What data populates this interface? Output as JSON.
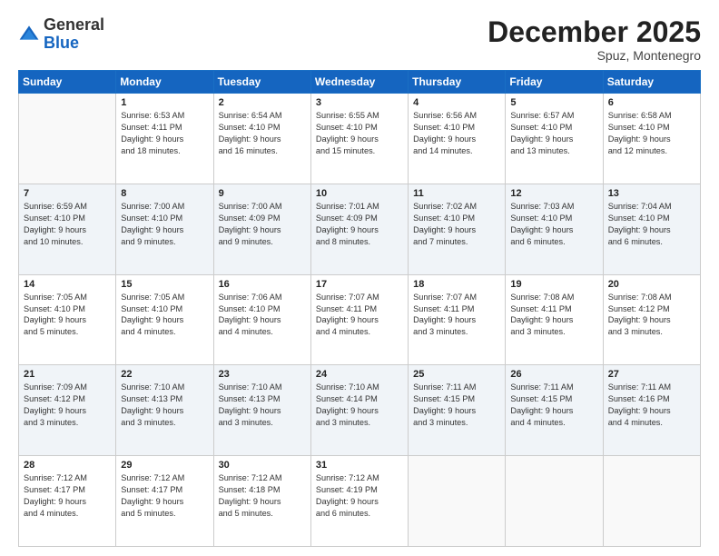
{
  "header": {
    "logo": {
      "general": "General",
      "blue": "Blue"
    },
    "title": "December 2025",
    "subtitle": "Spuz, Montenegro"
  },
  "columns": [
    "Sunday",
    "Monday",
    "Tuesday",
    "Wednesday",
    "Thursday",
    "Friday",
    "Saturday"
  ],
  "weeks": [
    [
      {
        "day": "",
        "info": ""
      },
      {
        "day": "1",
        "info": "Sunrise: 6:53 AM\nSunset: 4:11 PM\nDaylight: 9 hours\nand 18 minutes."
      },
      {
        "day": "2",
        "info": "Sunrise: 6:54 AM\nSunset: 4:10 PM\nDaylight: 9 hours\nand 16 minutes."
      },
      {
        "day": "3",
        "info": "Sunrise: 6:55 AM\nSunset: 4:10 PM\nDaylight: 9 hours\nand 15 minutes."
      },
      {
        "day": "4",
        "info": "Sunrise: 6:56 AM\nSunset: 4:10 PM\nDaylight: 9 hours\nand 14 minutes."
      },
      {
        "day": "5",
        "info": "Sunrise: 6:57 AM\nSunset: 4:10 PM\nDaylight: 9 hours\nand 13 minutes."
      },
      {
        "day": "6",
        "info": "Sunrise: 6:58 AM\nSunset: 4:10 PM\nDaylight: 9 hours\nand 12 minutes."
      }
    ],
    [
      {
        "day": "7",
        "info": "Sunrise: 6:59 AM\nSunset: 4:10 PM\nDaylight: 9 hours\nand 10 minutes."
      },
      {
        "day": "8",
        "info": "Sunrise: 7:00 AM\nSunset: 4:10 PM\nDaylight: 9 hours\nand 9 minutes."
      },
      {
        "day": "9",
        "info": "Sunrise: 7:00 AM\nSunset: 4:09 PM\nDaylight: 9 hours\nand 9 minutes."
      },
      {
        "day": "10",
        "info": "Sunrise: 7:01 AM\nSunset: 4:09 PM\nDaylight: 9 hours\nand 8 minutes."
      },
      {
        "day": "11",
        "info": "Sunrise: 7:02 AM\nSunset: 4:10 PM\nDaylight: 9 hours\nand 7 minutes."
      },
      {
        "day": "12",
        "info": "Sunrise: 7:03 AM\nSunset: 4:10 PM\nDaylight: 9 hours\nand 6 minutes."
      },
      {
        "day": "13",
        "info": "Sunrise: 7:04 AM\nSunset: 4:10 PM\nDaylight: 9 hours\nand 6 minutes."
      }
    ],
    [
      {
        "day": "14",
        "info": "Sunrise: 7:05 AM\nSunset: 4:10 PM\nDaylight: 9 hours\nand 5 minutes."
      },
      {
        "day": "15",
        "info": "Sunrise: 7:05 AM\nSunset: 4:10 PM\nDaylight: 9 hours\nand 4 minutes."
      },
      {
        "day": "16",
        "info": "Sunrise: 7:06 AM\nSunset: 4:10 PM\nDaylight: 9 hours\nand 4 minutes."
      },
      {
        "day": "17",
        "info": "Sunrise: 7:07 AM\nSunset: 4:11 PM\nDaylight: 9 hours\nand 4 minutes."
      },
      {
        "day": "18",
        "info": "Sunrise: 7:07 AM\nSunset: 4:11 PM\nDaylight: 9 hours\nand 3 minutes."
      },
      {
        "day": "19",
        "info": "Sunrise: 7:08 AM\nSunset: 4:11 PM\nDaylight: 9 hours\nand 3 minutes."
      },
      {
        "day": "20",
        "info": "Sunrise: 7:08 AM\nSunset: 4:12 PM\nDaylight: 9 hours\nand 3 minutes."
      }
    ],
    [
      {
        "day": "21",
        "info": "Sunrise: 7:09 AM\nSunset: 4:12 PM\nDaylight: 9 hours\nand 3 minutes."
      },
      {
        "day": "22",
        "info": "Sunrise: 7:10 AM\nSunset: 4:13 PM\nDaylight: 9 hours\nand 3 minutes."
      },
      {
        "day": "23",
        "info": "Sunrise: 7:10 AM\nSunset: 4:13 PM\nDaylight: 9 hours\nand 3 minutes."
      },
      {
        "day": "24",
        "info": "Sunrise: 7:10 AM\nSunset: 4:14 PM\nDaylight: 9 hours\nand 3 minutes."
      },
      {
        "day": "25",
        "info": "Sunrise: 7:11 AM\nSunset: 4:15 PM\nDaylight: 9 hours\nand 3 minutes."
      },
      {
        "day": "26",
        "info": "Sunrise: 7:11 AM\nSunset: 4:15 PM\nDaylight: 9 hours\nand 4 minutes."
      },
      {
        "day": "27",
        "info": "Sunrise: 7:11 AM\nSunset: 4:16 PM\nDaylight: 9 hours\nand 4 minutes."
      }
    ],
    [
      {
        "day": "28",
        "info": "Sunrise: 7:12 AM\nSunset: 4:17 PM\nDaylight: 9 hours\nand 4 minutes."
      },
      {
        "day": "29",
        "info": "Sunrise: 7:12 AM\nSunset: 4:17 PM\nDaylight: 9 hours\nand 5 minutes."
      },
      {
        "day": "30",
        "info": "Sunrise: 7:12 AM\nSunset: 4:18 PM\nDaylight: 9 hours\nand 5 minutes."
      },
      {
        "day": "31",
        "info": "Sunrise: 7:12 AM\nSunset: 4:19 PM\nDaylight: 9 hours\nand 6 minutes."
      },
      {
        "day": "",
        "info": ""
      },
      {
        "day": "",
        "info": ""
      },
      {
        "day": "",
        "info": ""
      }
    ]
  ]
}
